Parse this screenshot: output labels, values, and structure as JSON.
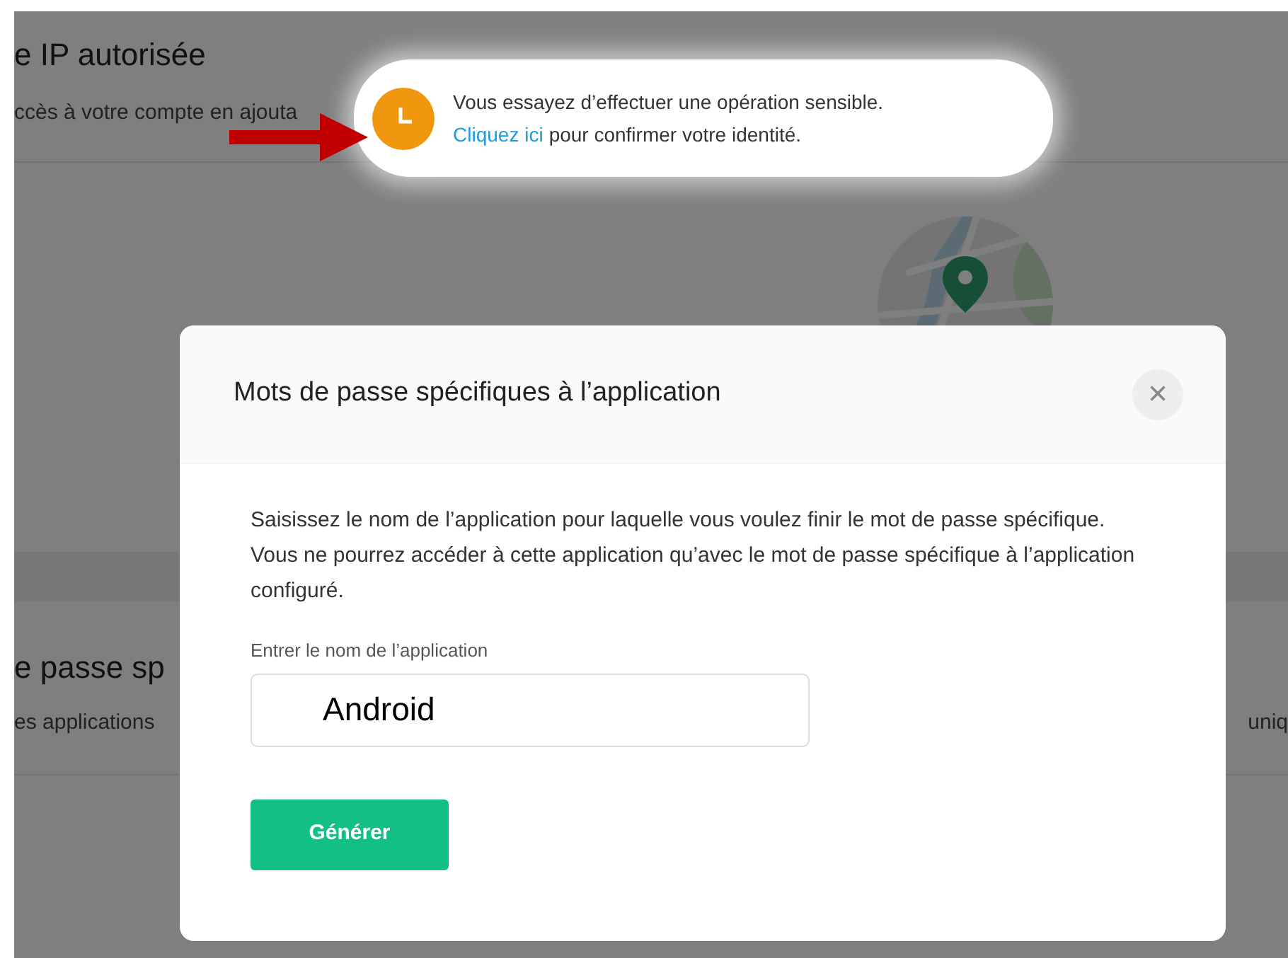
{
  "background": {
    "heading": "e IP autorisée",
    "description": "ccès à votre compte en ajouta",
    "section_heading": "e passe sp",
    "section_description": "es applications",
    "section_description_end": "uniq"
  },
  "toast": {
    "message": "Vous essayez d’effectuer une opération sensible.",
    "link": "Cliquez ici",
    "message_end": "pour confirmer votre identité."
  },
  "dialog": {
    "title": "Mots de passe spécifiques à l’application",
    "close": "×",
    "body": "Saisissez le nom de l’application pour laquelle vous voulez finir le mot de passe spécifique. Vous ne pourrez accéder à cette application qu’avec le mot de passe spécifique à l’application configuré.",
    "field": {
      "label": "Entrer le nom de l’application",
      "value": "Android"
    },
    "button": "Générer"
  }
}
